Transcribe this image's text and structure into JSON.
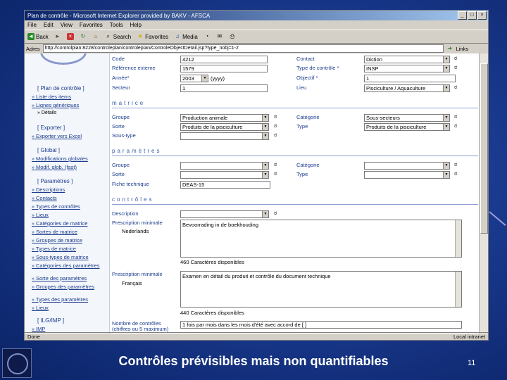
{
  "window": {
    "title": "Plan de contrôle - Microsoft Internet Explorer provided by BAKV - AFSCA",
    "menu": [
      "File",
      "Edit",
      "View",
      "Favorites",
      "Tools",
      "Help"
    ],
    "toolbar": {
      "back": "Back",
      "search": "Search",
      "favorites": "Favorites",
      "media": "Media"
    },
    "address_label": "Adres",
    "address": "http://controlplan:8228/controleplan/controleplan/ControleObjectDetail.jsp?type_nobj=1-2",
    "links_label": "Links"
  },
  "sidebar": {
    "plan_header": "[ Plan de contrôle ]",
    "plan_links": [
      "Liste des items",
      "Lignes génériques"
    ],
    "plan_sub": "Détails",
    "export_header": "[ Exporter ]",
    "export_links": [
      "Exporter vers Excel"
    ],
    "global_header": "[ Global ]",
    "global_links": [
      "Modifications globales",
      "Modif. glob. (fast)"
    ],
    "params_header": "[ Paramètres ]",
    "params_links": [
      "Descriptions",
      "Contacts",
      "Types de contrôles",
      "Lieux",
      "Catégories de matrice",
      "Sortes de matrice",
      "Groupes de matrice",
      "Types de matrice",
      "Sous-types de matrice",
      "Catégories des paramètres",
      "Sorte des paramètres",
      "Groupes des paramètres",
      "Types des paramètres",
      "Lieux"
    ],
    "ilg_header": "[ ILG/IMP ]",
    "ilg_links": [
      "IMP"
    ]
  },
  "form": {
    "code_label": "Code",
    "code_value": "4212",
    "ref_label": "Référence externe",
    "ref_value": "1579",
    "annee_label": "Année*",
    "annee_value": "2003",
    "annee_unit": "(yyyy)",
    "secteur_label": "Secteur",
    "secteur_value": "1",
    "contact_label": "Contact",
    "contact_value": "Diction",
    "typecontrole_label": "Type de contrôle *",
    "typecontrole_value": "INSP",
    "objectif_label": "Objectif *",
    "objectif_value": "1",
    "lieu_label": "Lieu",
    "lieu_value": "Pisciculture / Aquaculture",
    "matrice_section": "matrice",
    "groupe_label": "Groupe",
    "groupe_value": "Production animale",
    "sorte_label": "Sorte",
    "sorte_value": "Produits de la pisciculture",
    "soustype_label": "Sous-type",
    "categorie_label": "Catégorie",
    "categorie_value": "Sous-secteurs",
    "type_label": "Type",
    "type_value": "Produits de la pisciculture",
    "param_section": "paramètres",
    "pgroupe_label": "Groupe",
    "psorte_label": "Sorte",
    "fiche_label": "Fiche technique",
    "fiche_value": "DEAS-15",
    "pcategorie_label": "Catégorie",
    "ptype_label": "Type",
    "controles_section": "contrôles",
    "description_label": "Description",
    "presc1_label": "Prescription minimale",
    "presc1_lang": "Nederlands",
    "presc1_text": "Bevoorrading in de boekhouding",
    "presc1_count": "460 Caractères disponibles",
    "presc2_label": "Prescription minimale",
    "presc2_lang": "Français",
    "presc2_text": "Examen en détail du produit et contrôle du document technique",
    "presc2_count": "440 Caractères disponibles",
    "nbr_label": "Nombre de contrôles (chiffres ou 5 maximum)",
    "nbr_value": "1 fois par mois dans les mois d'été avec accord de [ ]"
  },
  "status": {
    "left": "Done",
    "right": "Local intranet"
  },
  "slide": {
    "caption": "Contrôles prévisibles mais non quantifiables",
    "page": "11"
  }
}
